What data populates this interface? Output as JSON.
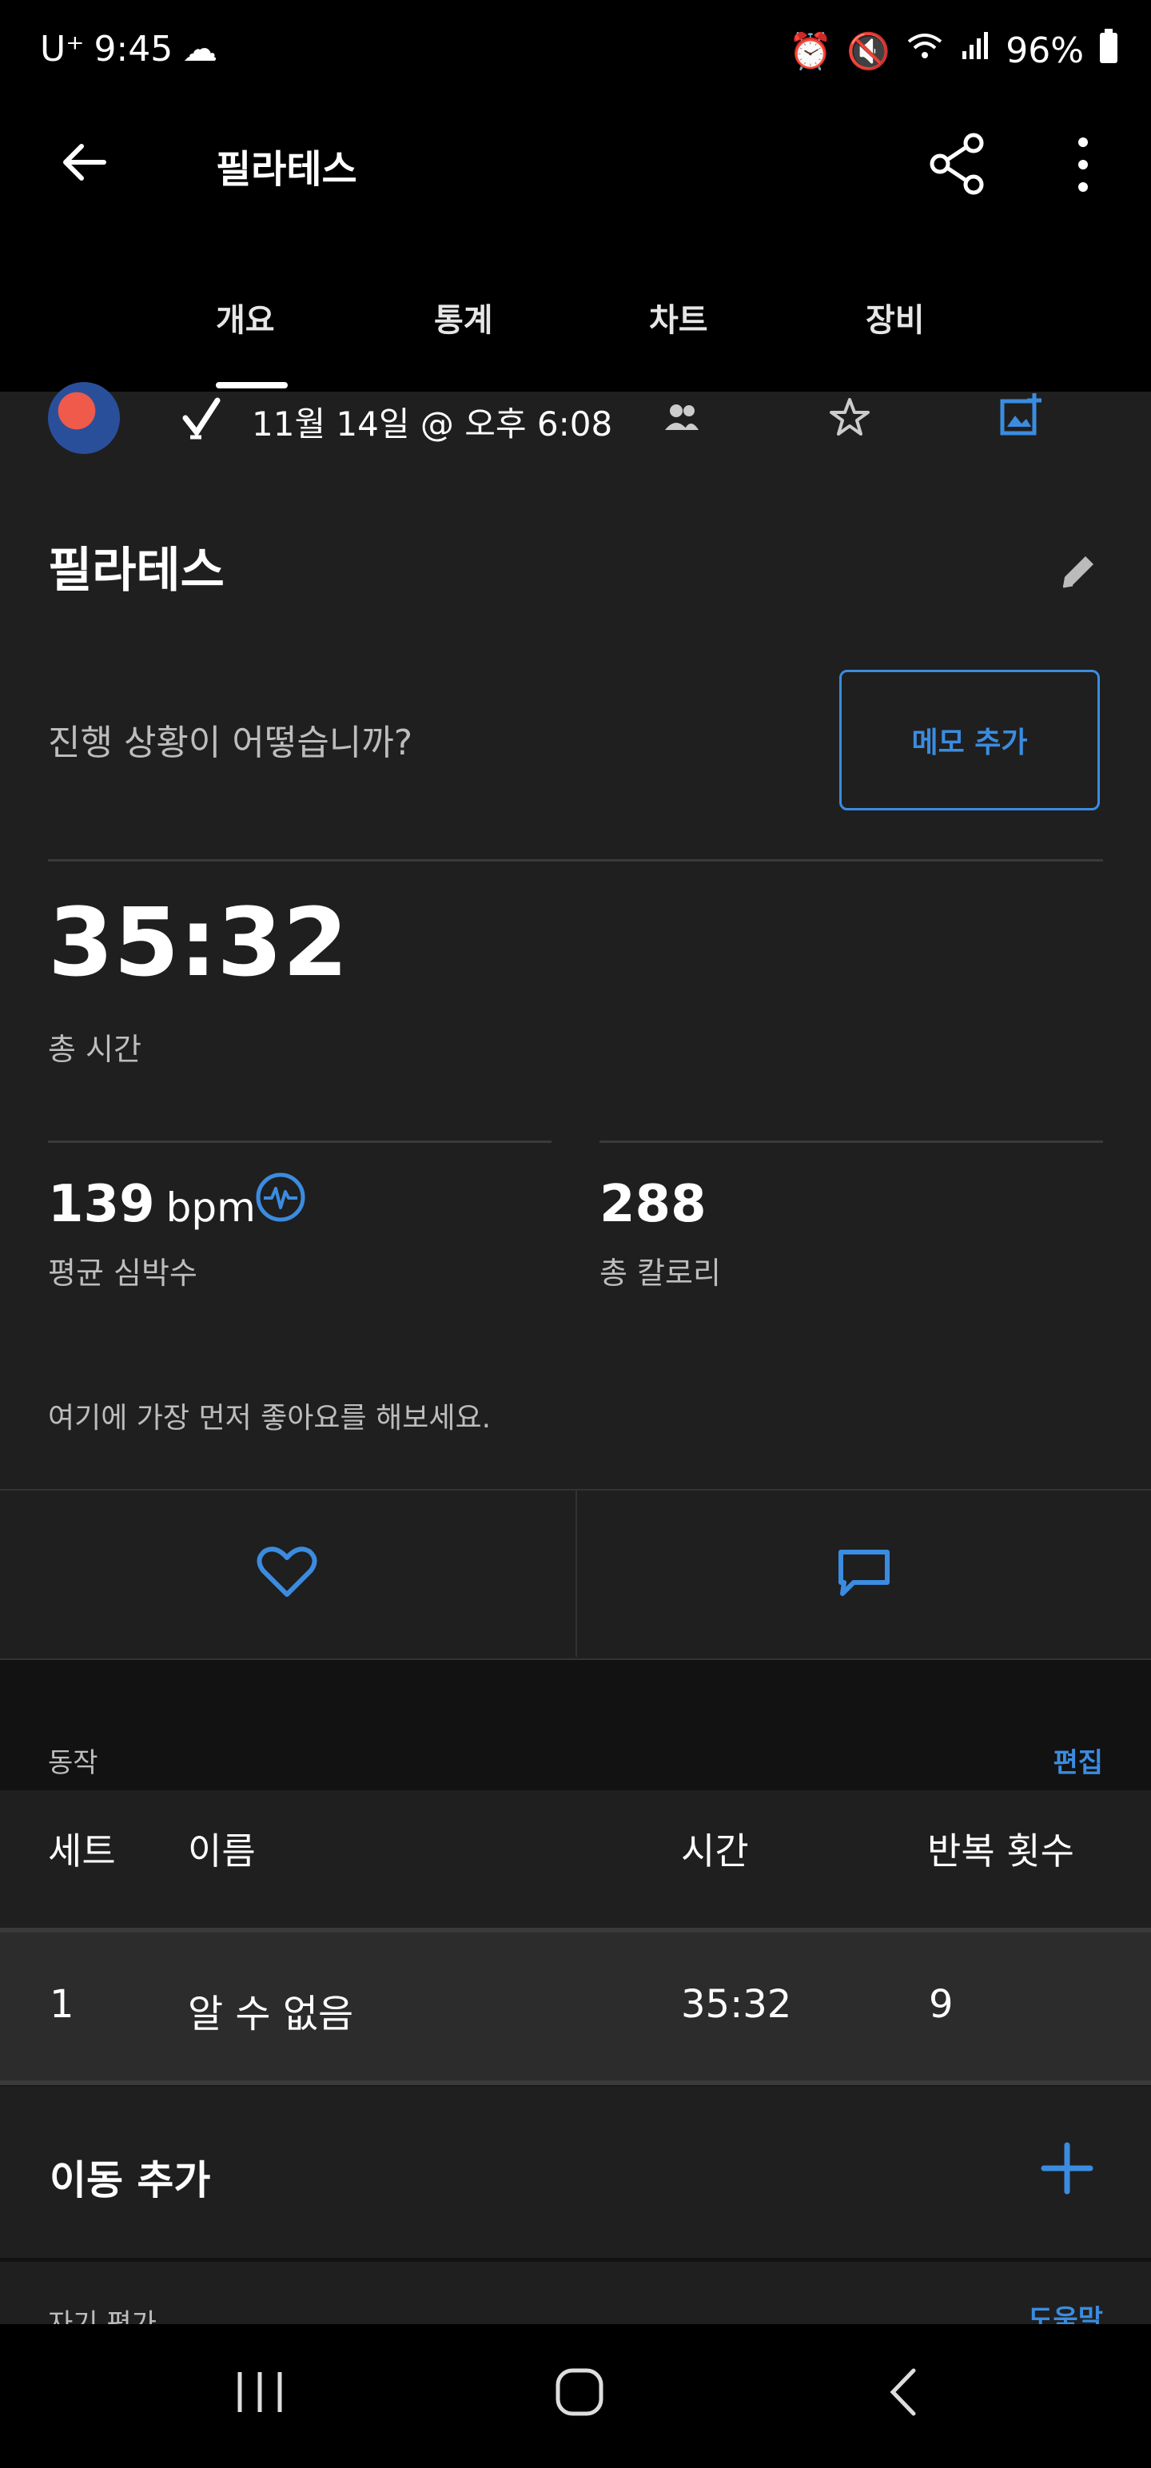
{
  "status_bar": {
    "carrier": "U⁺",
    "time": "9:45",
    "battery": "96%"
  },
  "app_bar": {
    "title": "필라테스",
    "tabs": [
      "개요",
      "통계",
      "차트",
      "장비"
    ],
    "active_tab": "개요"
  },
  "activity": {
    "date": "11월 14일 @ 오후 6:08",
    "title": "필라테스",
    "prompt": "진행 상황이 어떻습니까?",
    "memo_button": "메모 추가",
    "total_time": "35:32",
    "total_time_label": "총 시간",
    "heart_rate_value": "139",
    "heart_rate_unit": "bpm",
    "heart_rate_label": "평균 심박수",
    "calories_value": "288",
    "calories_label": "총 칼로리",
    "like_hint": "여기에 가장 먼저 좋아요를 해보세요."
  },
  "moves": {
    "section_label": "동작",
    "edit_label": "편집",
    "columns": [
      "세트",
      "이름",
      "시간",
      "반복 횟수"
    ],
    "rows": [
      {
        "set": "1",
        "name": "알 수 없음",
        "time": "35:32",
        "reps": "9"
      }
    ],
    "add_move_label": "이동 추가"
  },
  "self_eval": {
    "label": "자기 평가",
    "help_label": "도움말"
  },
  "colors": {
    "accent": "#3b8ce0",
    "background": "#121212",
    "card": "#1f1f1f"
  },
  "icons": [
    "back-arrow-icon",
    "share-icon",
    "more-vert-icon",
    "check-icon",
    "people-icon",
    "star-icon",
    "add-photo-icon",
    "edit-pencil-icon",
    "heart-rate-icon",
    "heart-icon",
    "comment-icon",
    "plus-icon"
  ]
}
